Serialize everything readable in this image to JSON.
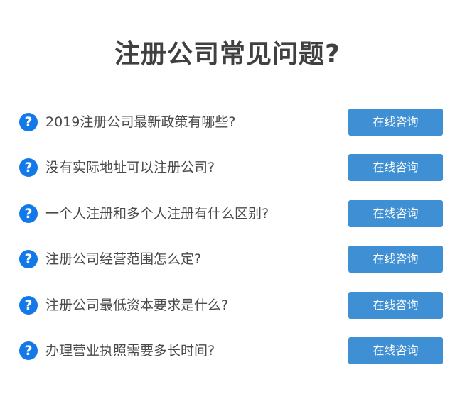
{
  "page": {
    "title": "注册公司常见问题?"
  },
  "colors": {
    "accent_icon": "#1479e8",
    "button_bg": "#3f8fd4",
    "title_text": "#404040",
    "question_text": "#4a4a4a"
  },
  "faq": {
    "icon": "question-circle-icon",
    "icon_glyph": "?",
    "items": [
      {
        "question": "2019注册公司最新政策有哪些?",
        "button": "在线咨询"
      },
      {
        "question": "没有实际地址可以注册公司?",
        "button": "在线咨询"
      },
      {
        "question": "一个人注册和多个人注册有什么区别?",
        "button": "在线咨询"
      },
      {
        "question": "注册公司经营范围怎么定?",
        "button": "在线咨询"
      },
      {
        "question": "注册公司最低资本要求是什么?",
        "button": "在线咨询"
      },
      {
        "question": "办理营业执照需要多长时间?",
        "button": "在线咨询"
      }
    ]
  }
}
